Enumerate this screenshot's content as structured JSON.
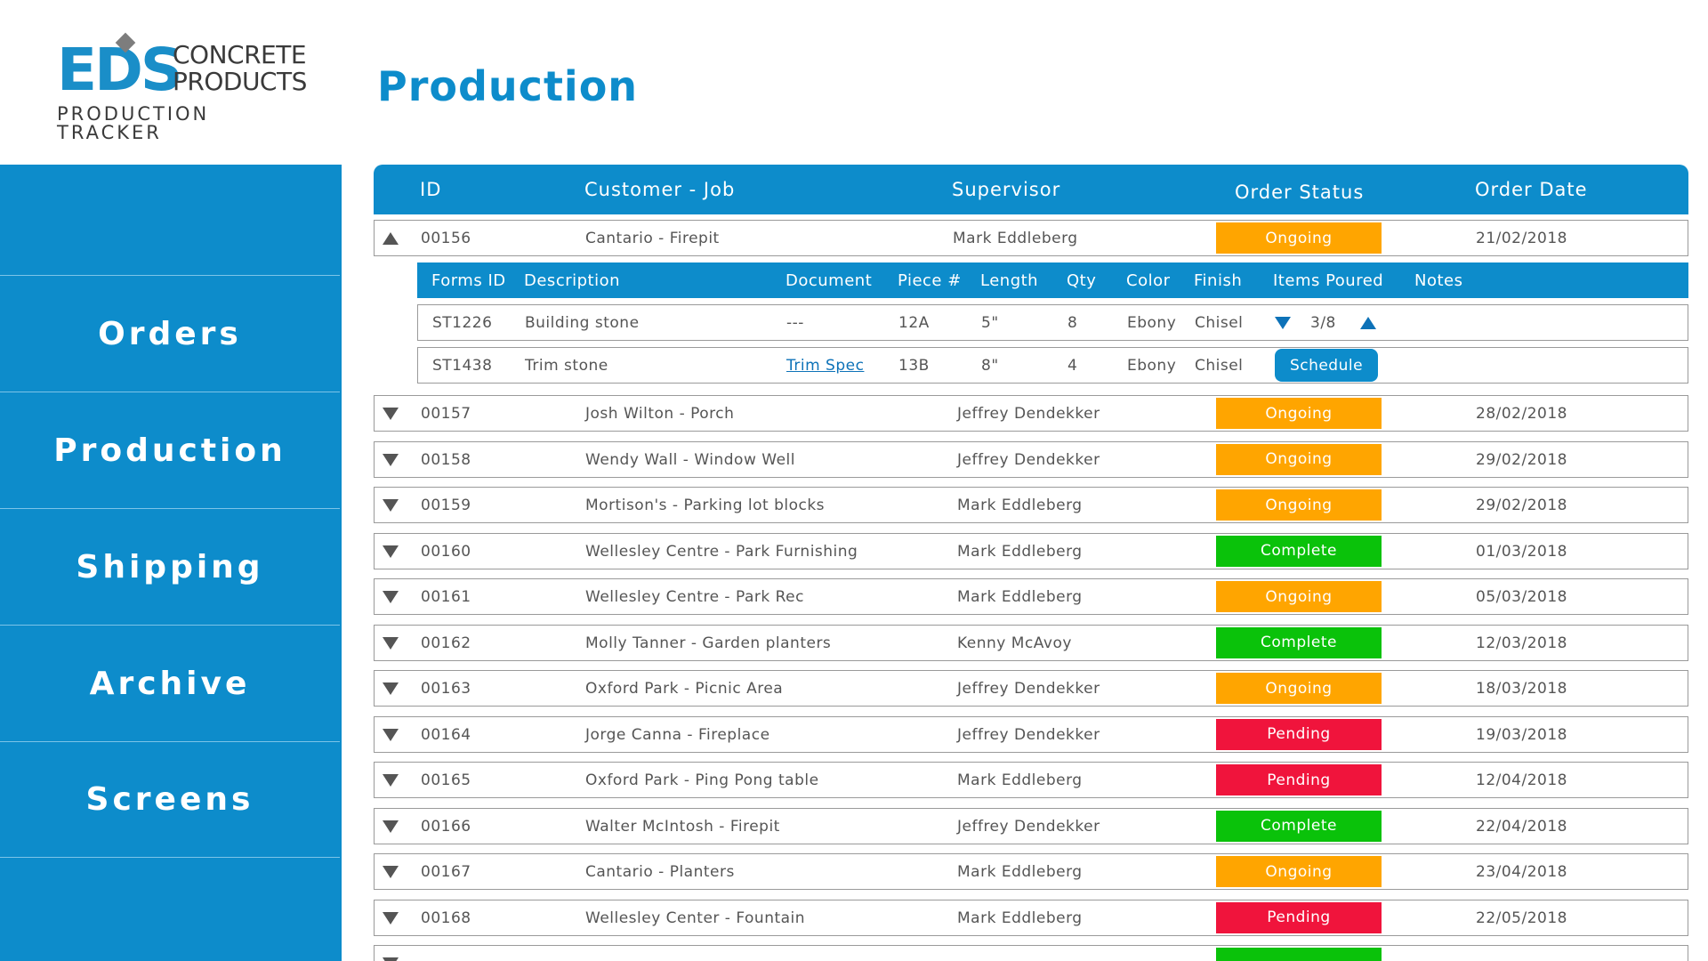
{
  "logo": {
    "eds": "EDS",
    "concrete": "CONCRETE",
    "products": "PRODUCTS",
    "tracker": "PRODUCTION TRACKER"
  },
  "page": {
    "title": "Production"
  },
  "colors": {
    "accent": "#0d8ccb",
    "ongoing": "#ffa500",
    "complete": "#0ac20a",
    "pending": "#f0143c"
  },
  "sidebar": {
    "items": [
      {
        "label": "Orders"
      },
      {
        "label": "Production"
      },
      {
        "label": "Shipping"
      },
      {
        "label": "Archive"
      },
      {
        "label": "Screens"
      }
    ]
  },
  "table": {
    "headers": {
      "id": "ID",
      "job": "Customer - Job",
      "supervisor": "Supervisor",
      "status": "Order Status",
      "date": "Order Date"
    },
    "expanded": {
      "id": "00156",
      "job": "Cantario - Firepit",
      "supervisor": "Mark Eddleberg",
      "status": "Ongoing",
      "status_key": "ongoing",
      "date": "21/02/2018",
      "sub_headers": {
        "forms_id": "Forms ID",
        "description": "Description",
        "document": "Document",
        "piece": "Piece #",
        "length": "Length",
        "qty": "Qty",
        "color": "Color",
        "finish": "Finish",
        "items_poured": "Items Poured",
        "notes": "Notes"
      },
      "items": [
        {
          "forms_id": "ST1226",
          "description": "Building stone",
          "document": "---",
          "piece": "12A",
          "length": "5\"",
          "qty": "8",
          "color": "Ebony",
          "finish": "Chisel",
          "items_poured": "3/8",
          "notes": ""
        },
        {
          "forms_id": "ST1438",
          "description": "Trim stone",
          "document": "Trim Spec",
          "piece": "13B",
          "length": "8\"",
          "qty": "4",
          "color": "Ebony",
          "finish": "Chisel",
          "action": "Schedule",
          "notes": ""
        }
      ]
    },
    "rows": [
      {
        "id": "00157",
        "job": "Josh Wilton - Porch",
        "supervisor": "Jeffrey Dendekker",
        "status": "Ongoing",
        "status_key": "ongoing",
        "date": "28/02/2018"
      },
      {
        "id": "00158",
        "job": "Wendy Wall - Window Well",
        "supervisor": "Jeffrey Dendekker",
        "status": "Ongoing",
        "status_key": "ongoing",
        "date": "29/02/2018"
      },
      {
        "id": "00159",
        "job": "Mortison's - Parking lot blocks",
        "supervisor": "Mark Eddleberg",
        "status": "Ongoing",
        "status_key": "ongoing",
        "date": "29/02/2018"
      },
      {
        "id": "00160",
        "job": "Wellesley Centre - Park Furnishing",
        "supervisor": "Mark Eddleberg",
        "status": "Complete",
        "status_key": "complete",
        "date": "01/03/2018"
      },
      {
        "id": "00161",
        "job": "Wellesley Centre - Park Rec",
        "supervisor": "Mark Eddleberg",
        "status": "Ongoing",
        "status_key": "ongoing",
        "date": "05/03/2018"
      },
      {
        "id": "00162",
        "job": "Molly Tanner - Garden planters",
        "supervisor": "Kenny McAvoy",
        "status": "Complete",
        "status_key": "complete",
        "date": "12/03/2018"
      },
      {
        "id": "00163",
        "job": "Oxford Park - Picnic Area",
        "supervisor": "Jeffrey Dendekker",
        "status": "Ongoing",
        "status_key": "ongoing",
        "date": "18/03/2018"
      },
      {
        "id": "00164",
        "job": "Jorge Canna - Fireplace",
        "supervisor": "Jeffrey Dendekker",
        "status": "Pending",
        "status_key": "pending",
        "date": "19/03/2018"
      },
      {
        "id": "00165",
        "job": "Oxford Park - Ping Pong table",
        "supervisor": "Mark Eddleberg",
        "status": "Pending",
        "status_key": "pending",
        "date": "12/04/2018"
      },
      {
        "id": "00166",
        "job": "Walter McIntosh - Firepit",
        "supervisor": "Jeffrey Dendekker",
        "status": "Complete",
        "status_key": "complete",
        "date": "22/04/2018"
      },
      {
        "id": "00167",
        "job": "Cantario - Planters",
        "supervisor": "Mark Eddleberg",
        "status": "Ongoing",
        "status_key": "ongoing",
        "date": "23/04/2018"
      },
      {
        "id": "00168",
        "job": "Wellesley Center - Fountain",
        "supervisor": "Mark Eddleberg",
        "status": "Pending",
        "status_key": "pending",
        "date": "22/05/2018"
      },
      {
        "id": "",
        "job": "",
        "supervisor": "",
        "status": "",
        "status_key": "complete",
        "date": ""
      }
    ]
  }
}
